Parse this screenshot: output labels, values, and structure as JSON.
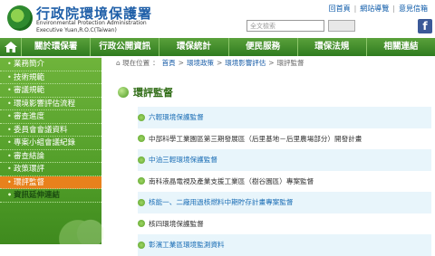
{
  "header": {
    "logo_zh": "行政院環境保護署",
    "logo_en1": "Environmental Protection Administration",
    "logo_en2": "Executive Yuan,R.O.C(Taiwan)",
    "top_links": [
      "回首頁",
      "網站導覽",
      "意見信箱"
    ],
    "search_placeholder": "全文檢索",
    "search_button": "",
    "fb_label": "f"
  },
  "nav": {
    "items": [
      "關於環保署",
      "行政公開資訊",
      "環保統計",
      "便民服務",
      "環保法規",
      "相關連結"
    ]
  },
  "sidebar": {
    "items": [
      {
        "label": "業務簡介"
      },
      {
        "label": "技術規範"
      },
      {
        "label": "審議規範"
      },
      {
        "label": "環境影響評估流程"
      },
      {
        "label": "審查進度"
      },
      {
        "label": "委員會會議資料"
      },
      {
        "label": "專案小組會議紀錄"
      },
      {
        "label": "審查結論"
      },
      {
        "label": "政策環評"
      },
      {
        "label": "環評監督"
      },
      {
        "label": "資訊延伸連結"
      }
    ],
    "active_index": 9
  },
  "breadcrumb": {
    "prefix": "現在位置",
    "items": [
      "首頁",
      "環境政策",
      "環境影響評估",
      "環評監督"
    ]
  },
  "page": {
    "title": "環評監督"
  },
  "list": {
    "items": [
      "六輕環境保護監督",
      "中部科學工業園區第三期發展區（后里基地－后里農場部分）開發計畫",
      "中油三輕環境保護監督",
      "南科液晶電視及產業支援工業區（樹谷園區）專案監督",
      "核能一、二廠用過核燃料中期貯存計畫專案監督",
      "核四環境保護監督",
      "彰濱工業區環境監測資料"
    ]
  },
  "colors": {
    "nav_green": "#2f7b1f",
    "sidebar_green": "#4d9a26",
    "active_orange": "#e8811c",
    "link_blue": "#1a5ea8"
  }
}
